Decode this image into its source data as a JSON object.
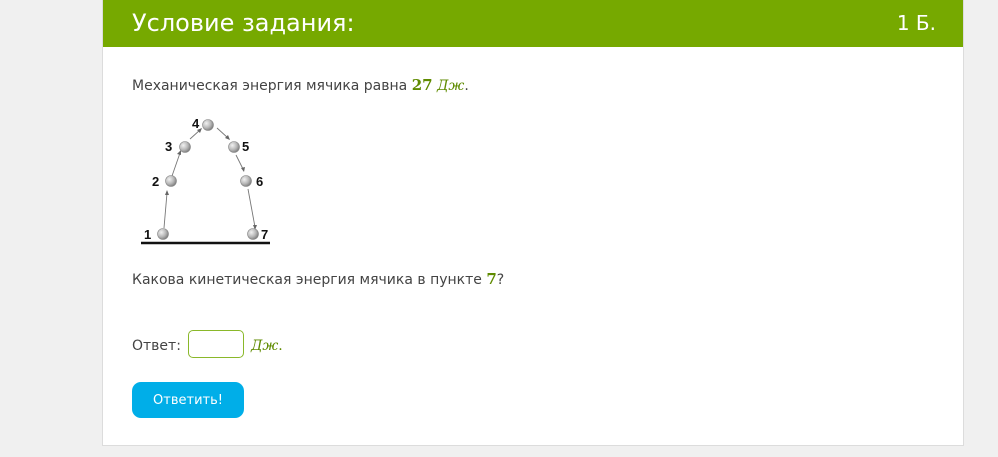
{
  "header": {
    "title": "Условие задания:",
    "points": "1 Б."
  },
  "statement": {
    "prefix": "Механическая энергия мячика равна ",
    "value": "27",
    "unit": "Дж",
    "suffix": "."
  },
  "diagram": {
    "labels": [
      "1",
      "2",
      "3",
      "4",
      "5",
      "6",
      "7"
    ]
  },
  "question": {
    "prefix": "Какова кинетическая энергия мячика в пункте ",
    "point": "7",
    "suffix": "?"
  },
  "answer": {
    "label": "Ответ:",
    "value": "",
    "placeholder": "",
    "unit": "Дж",
    "unit_suffix": "."
  },
  "submit": {
    "label": "Ответить!"
  },
  "colors": {
    "header_bg": "#76a900",
    "accent_green": "#5f8b00",
    "button_bg": "#00aee8"
  }
}
